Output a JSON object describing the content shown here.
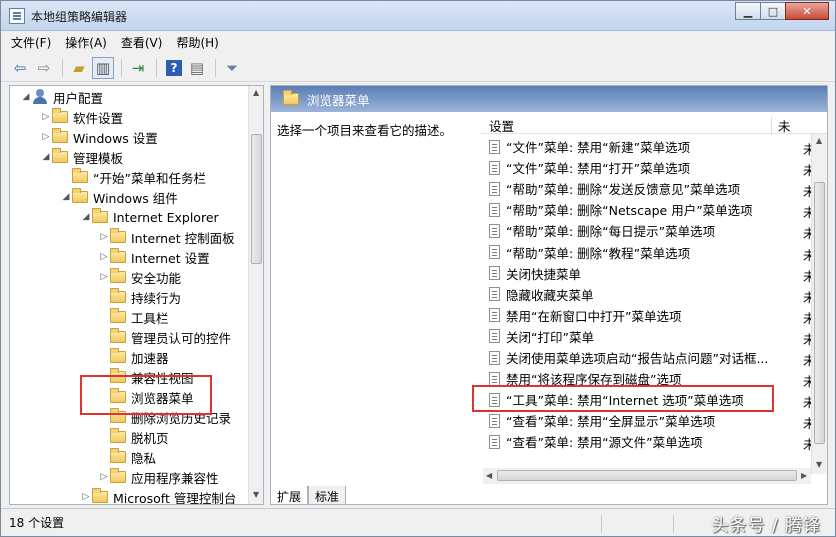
{
  "window": {
    "title": "本地组策略编辑器"
  },
  "menu": [
    "文件(F)",
    "操作(A)",
    "查看(V)",
    "帮助(H)"
  ],
  "toolbar": [
    "back-arrow-icon",
    "forward-arrow-icon",
    "up-folder-icon",
    "show-hide-tree-icon",
    "export-list-icon",
    "help-icon",
    "properties-icon",
    "filter-icon"
  ],
  "tree": [
    {
      "label": "用户配置",
      "arrow": "◢",
      "icon": "user",
      "level": 0
    },
    {
      "label": "软件设置",
      "arrow": "▷",
      "icon": "folder",
      "level": 1
    },
    {
      "label": "Windows 设置",
      "arrow": "▷",
      "icon": "folder",
      "level": 1
    },
    {
      "label": "管理模板",
      "arrow": "◢",
      "icon": "folder",
      "level": 1
    },
    {
      "label": "“开始”菜单和任务栏",
      "arrow": "",
      "icon": "folder",
      "level": 2
    },
    {
      "label": "Windows 组件",
      "arrow": "◢",
      "icon": "folder",
      "level": 2
    },
    {
      "label": "Internet Explorer",
      "arrow": "◢",
      "icon": "folder",
      "level": 3
    },
    {
      "label": "Internet 控制面板",
      "arrow": "▷",
      "icon": "folder",
      "level": 4
    },
    {
      "label": "Internet 设置",
      "arrow": "▷",
      "icon": "folder",
      "level": 4
    },
    {
      "label": "安全功能",
      "arrow": "▷",
      "icon": "folder",
      "level": 4
    },
    {
      "label": "持续行为",
      "arrow": "",
      "icon": "folder",
      "level": 4
    },
    {
      "label": "工具栏",
      "arrow": "",
      "icon": "folder",
      "level": 4
    },
    {
      "label": "管理员认可的控件",
      "arrow": "",
      "icon": "folder",
      "level": 4
    },
    {
      "label": "加速器",
      "arrow": "",
      "icon": "folder",
      "level": 4
    },
    {
      "label": "兼容性视图",
      "arrow": "",
      "icon": "folder",
      "level": 4
    },
    {
      "label": "浏览器菜单",
      "arrow": "",
      "icon": "folder",
      "level": 4,
      "selected": true
    },
    {
      "label": "删除浏览历史记录",
      "arrow": "",
      "icon": "folder",
      "level": 4
    },
    {
      "label": "脱机页",
      "arrow": "",
      "icon": "folder",
      "level": 4
    },
    {
      "label": "隐私",
      "arrow": "",
      "icon": "folder",
      "level": 4
    },
    {
      "label": "应用程序兼容性",
      "arrow": "▷",
      "icon": "folder",
      "level": 4
    },
    {
      "label": "Microsoft 管理控制台",
      "arrow": "▷",
      "icon": "folder",
      "level": 3
    }
  ],
  "right": {
    "header": "浏览器菜单",
    "description": "选择一个项目来查看它的描述。",
    "col_setting": "设置",
    "col_state": "未",
    "items": [
      "“文件”菜单: 禁用“新建”菜单选项",
      "“文件”菜单: 禁用“打开”菜单选项",
      "“帮助”菜单: 删除“发送反馈意见”菜单选项",
      "“帮助”菜单: 删除“Netscape 用户”菜单选项",
      "“帮助”菜单: 删除“每日提示”菜单选项",
      "“帮助”菜单: 删除“教程”菜单选项",
      "关闭快捷菜单",
      "隐藏收藏夹菜单",
      "禁用“在新窗口中打开”菜单选项",
      "关闭“打印”菜单",
      "关闭使用菜单选项启动“报告站点问题”对话框...",
      "禁用“将该程序保存到磁盘”选项",
      "“工具”菜单: 禁用“Internet 选项”菜单选项",
      "“查看”菜单: 禁用“全屏显示”菜单选项",
      "“查看”菜单: 禁用“源文件”菜单选项"
    ],
    "item_state": "未"
  },
  "tabs": [
    "扩展",
    "标准"
  ],
  "status": "18 个设置",
  "watermark": "头条号 / 腾锋"
}
